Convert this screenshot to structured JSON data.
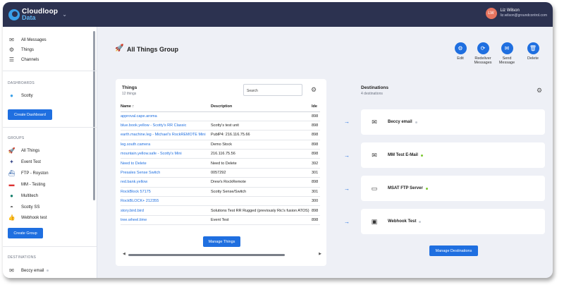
{
  "app": {
    "brand_line1": "Cloudloop",
    "brand_line2": "Data"
  },
  "user": {
    "initials": "LW",
    "name": "Liz Wilson",
    "email": "liz.wilson@groundcontrol.com"
  },
  "sidebar": {
    "nav": [
      {
        "label": "All Messages",
        "icon": "envelope-icon"
      },
      {
        "label": "Things",
        "icon": "chip-icon"
      },
      {
        "label": "Channels",
        "icon": "list-icon"
      }
    ],
    "dashboards_heading": "DASHBOARDS",
    "dashboards": [
      {
        "label": "Scotty",
        "icon": "globe-icon"
      }
    ],
    "create_dashboard": "Create Dashboard",
    "groups_heading": "GROUPS",
    "groups": [
      {
        "label": "All Things",
        "icon": "rocket-icon"
      },
      {
        "label": "Event Test",
        "icon": "satellite-icon"
      },
      {
        "label": "FTP - Royston",
        "icon": "ship-icon"
      },
      {
        "label": "MM - Testing",
        "icon": "car-icon"
      },
      {
        "label": "Multitech",
        "icon": "planet-icon"
      },
      {
        "label": "Scotty SS",
        "icon": "satellite-dish-icon"
      },
      {
        "label": "Webhook test",
        "icon": "thumbs-up-icon"
      }
    ],
    "create_group": "Create Group",
    "destinations_heading": "DESTINATIONS",
    "destinations": [
      {
        "label": "Beccy email",
        "icon": "envelope-icon"
      }
    ]
  },
  "page": {
    "title": "All Things Group"
  },
  "actions": [
    {
      "label": "Edit",
      "icon": "gear-icon"
    },
    {
      "label": "Redeliver Messages",
      "icon": "refresh-icon"
    },
    {
      "label": "Send Message",
      "icon": "send-icon"
    },
    {
      "label": "Delete",
      "icon": "trash-icon"
    }
  ],
  "things": {
    "title": "Things",
    "count": "12 things",
    "search_placeholder": "Search",
    "columns": [
      "Name ↑",
      "Description",
      "Ide"
    ],
    "rows": [
      {
        "name": "approval.cape.aroma",
        "description": "",
        "id": "898"
      },
      {
        "name": "blue.book.yellow - Scotty's RR Classic",
        "description": "Scotty's test unit",
        "id": "898"
      },
      {
        "name": "earth.machine.leg - Michael's RockREMOTE Mini",
        "description": "PublP4: 216.116.75.66",
        "id": "898"
      },
      {
        "name": "leg.south.camera",
        "description": "Demo Stock",
        "id": "898"
      },
      {
        "name": "mountain.yellow.safe - Scotty's Mini",
        "description": "216.116.75.56",
        "id": "898"
      },
      {
        "name": "Need to Delete",
        "description": "Need to Delete",
        "id": "392"
      },
      {
        "name": "Presales Sense Switch",
        "description": "0057292",
        "id": "301"
      },
      {
        "name": "red.bank.yellow",
        "description": "Drew's RockRemote",
        "id": "898"
      },
      {
        "name": "RockBlock 57175",
        "description": "Scotty Sense/Switch",
        "id": "301"
      },
      {
        "name": "RockBLOCK+ 212355",
        "description": "",
        "id": "300"
      },
      {
        "name": "story.bird.bird",
        "description": "Solutions Test RR Rugged (previously Ric's fusion ATOS)",
        "id": "898"
      },
      {
        "name": "tree.wheel.time",
        "description": "Event Test",
        "id": "898"
      }
    ],
    "manage_button": "Manage Things"
  },
  "destinations": {
    "title": "Destinations",
    "count": "4 destinations",
    "items": [
      {
        "name": "Beccy email",
        "icon": "envelope-icon",
        "status_color": "#c7ccd4"
      },
      {
        "name": "MM Test E-Mail",
        "icon": "envelope-icon",
        "status_color": "#7dc832"
      },
      {
        "name": "MSAT FTP Server",
        "icon": "folder-icon",
        "status_color": "#7dc832"
      },
      {
        "name": "Webhook Test",
        "icon": "browser-window-icon",
        "status_color": "#c7ccd4"
      }
    ],
    "manage_button": "Manage Destinations"
  },
  "colors": {
    "accent": "#1f6fe0",
    "topbar": "#2c3250",
    "status_ok": "#7dc832",
    "status_idle": "#c7ccd4"
  }
}
